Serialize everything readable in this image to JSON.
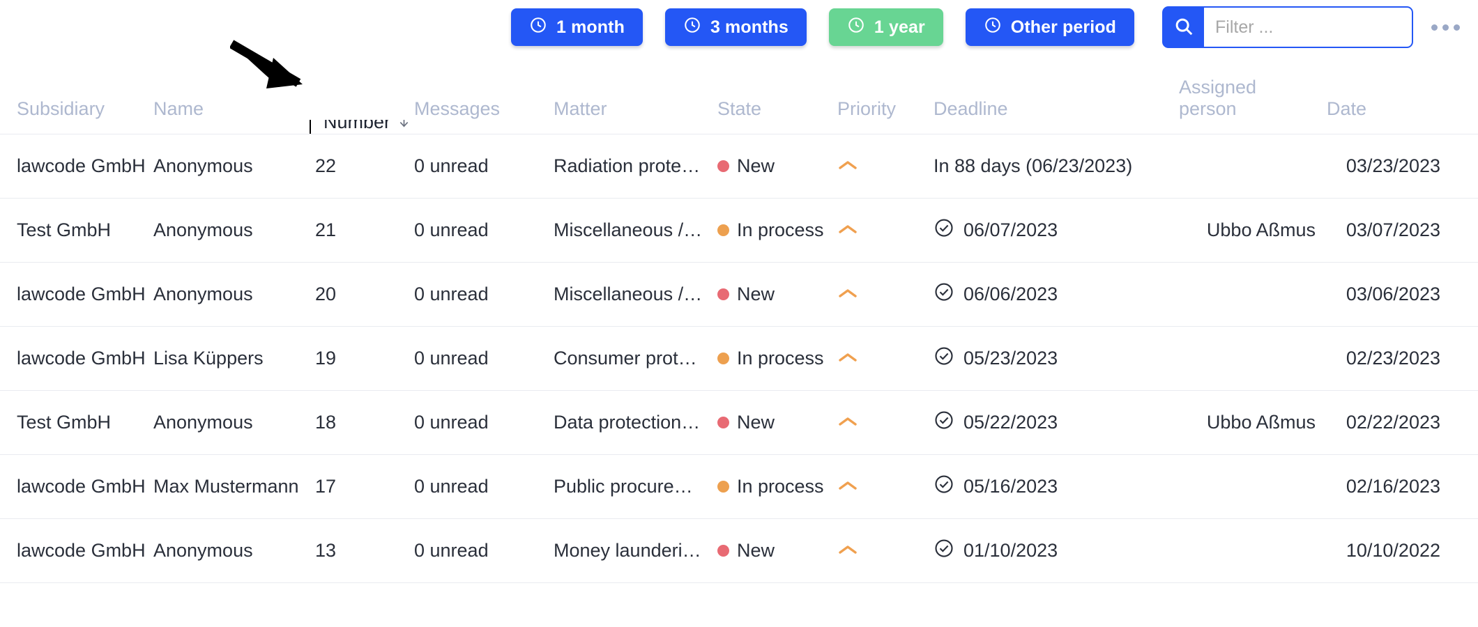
{
  "toolbar": {
    "buttons": [
      {
        "label": "1 month",
        "icon": "clock-icon",
        "active": false
      },
      {
        "label": "3 months",
        "icon": "clock-icon",
        "active": false
      },
      {
        "label": "1 year",
        "icon": "clock-icon",
        "active": true
      },
      {
        "label": "Other period",
        "icon": "clock-icon",
        "active": false
      }
    ],
    "search": {
      "icon": "search-icon",
      "value": "",
      "placeholder": "Filter ..."
    },
    "more_icon": "ellipsis-icon",
    "colors": {
      "primary": "#2457f5",
      "active": "#68d593"
    }
  },
  "table": {
    "columns": [
      {
        "key": "subsidiary",
        "label": "Subsidiary"
      },
      {
        "key": "name",
        "label": "Name"
      },
      {
        "key": "number",
        "label": "Number",
        "sorted": "descending",
        "sort_icon": "arrow-down-icon",
        "highlighted": true
      },
      {
        "key": "messages",
        "label": "Messages"
      },
      {
        "key": "matter",
        "label": "Matter"
      },
      {
        "key": "state",
        "label": "State"
      },
      {
        "key": "priority",
        "label": "Priority"
      },
      {
        "key": "deadline",
        "label": "Deadline"
      },
      {
        "key": "assigned_person",
        "label": "Assigned person"
      },
      {
        "key": "date",
        "label": "Date"
      }
    ],
    "rows": [
      {
        "subsidiary": "lawcode GmbH",
        "name": "Anonymous",
        "number": "22",
        "messages": "0 unread",
        "matter": "Radiation prote…",
        "state": "New",
        "state_color": "#e86a73",
        "priority_icon": "chevron-up-icon",
        "priority_color": "#f0a04f",
        "deadline": "In 88 days (06/23/2023)",
        "deadline_icon": "",
        "assigned_person": "",
        "date": "03/23/2023"
      },
      {
        "subsidiary": "Test GmbH",
        "name": "Anonymous",
        "number": "21",
        "messages": "0 unread",
        "matter": "Miscellaneous /…",
        "state": "In process",
        "state_color": "#eda04f",
        "priority_icon": "chevron-up-icon",
        "priority_color": "#f0a04f",
        "deadline": "06/07/2023",
        "deadline_icon": "check-circle-icon",
        "assigned_person": "Ubbo Aßmus",
        "date": "03/07/2023"
      },
      {
        "subsidiary": "lawcode GmbH",
        "name": "Anonymous",
        "number": "20",
        "messages": "0 unread",
        "matter": "Miscellaneous /…",
        "state": "New",
        "state_color": "#e86a73",
        "priority_icon": "chevron-up-icon",
        "priority_color": "#f0a04f",
        "deadline": "06/06/2023",
        "deadline_icon": "check-circle-icon",
        "assigned_person": "",
        "date": "03/06/2023"
      },
      {
        "subsidiary": "lawcode GmbH",
        "name": "Lisa Küppers",
        "number": "19",
        "messages": "0 unread",
        "matter": "Consumer prot…",
        "state": "In process",
        "state_color": "#eda04f",
        "priority_icon": "chevron-up-icon",
        "priority_color": "#f0a04f",
        "deadline": "05/23/2023",
        "deadline_icon": "check-circle-icon",
        "assigned_person": "",
        "date": "02/23/2023"
      },
      {
        "subsidiary": "Test GmbH",
        "name": "Anonymous",
        "number": "18",
        "messages": "0 unread",
        "matter": "Data protection…",
        "state": "New",
        "state_color": "#e86a73",
        "priority_icon": "chevron-up-icon",
        "priority_color": "#f0a04f",
        "deadline": "05/22/2023",
        "deadline_icon": "check-circle-icon",
        "assigned_person": "Ubbo Aßmus",
        "date": "02/22/2023"
      },
      {
        "subsidiary": "lawcode GmbH",
        "name": "Max Mustermann",
        "number": "17",
        "messages": "0 unread",
        "matter": "Public procure…",
        "state": "In process",
        "state_color": "#eda04f",
        "priority_icon": "chevron-up-icon",
        "priority_color": "#f0a04f",
        "deadline": "05/16/2023",
        "deadline_icon": "check-circle-icon",
        "assigned_person": "",
        "date": "02/16/2023"
      },
      {
        "subsidiary": "lawcode GmbH",
        "name": "Anonymous",
        "number": "13",
        "messages": "0 unread",
        "matter": "Money launderi…",
        "state": "New",
        "state_color": "#e86a73",
        "priority_icon": "chevron-up-icon",
        "priority_color": "#f0a04f",
        "deadline": "01/10/2023",
        "deadline_icon": "check-circle-icon",
        "assigned_person": "",
        "date": "10/10/2022"
      }
    ]
  },
  "annotation": {
    "arrow_icon": "pointer-arrow-icon",
    "target": "Number"
  }
}
